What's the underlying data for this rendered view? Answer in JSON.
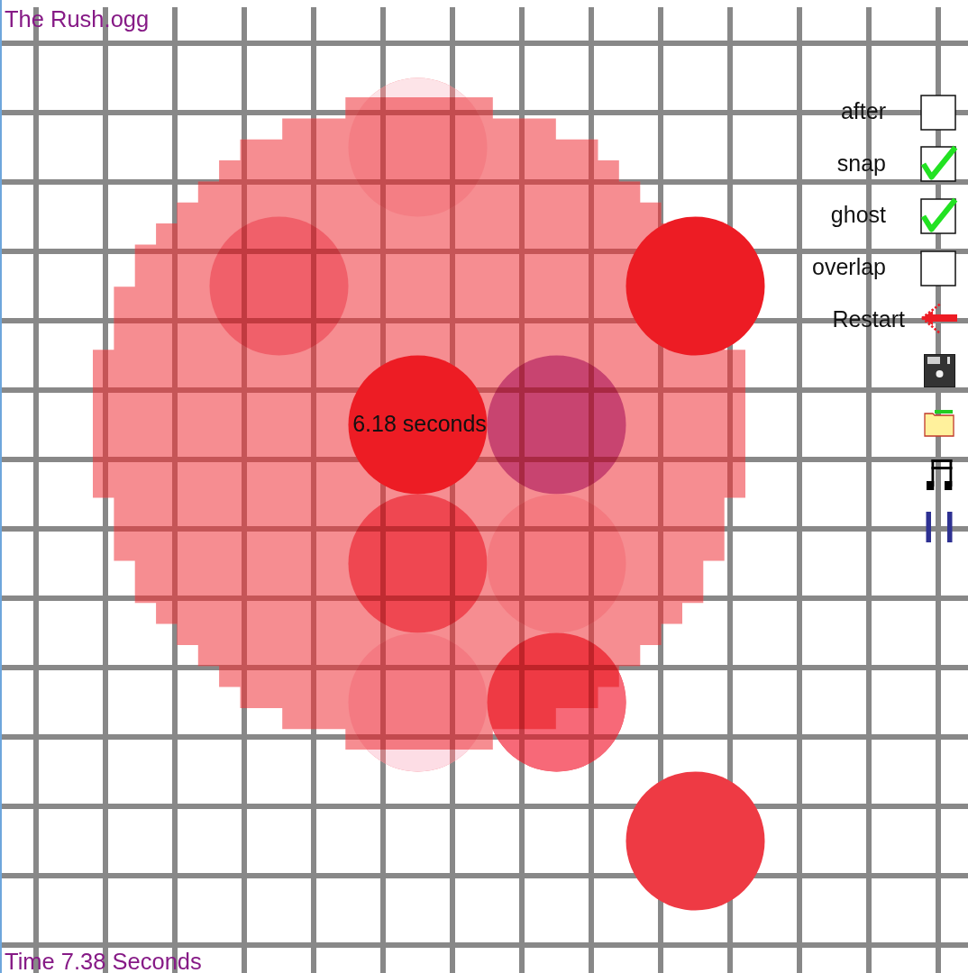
{
  "file": {
    "name": "The Rush.ogg"
  },
  "canvas": {
    "circles": [
      {
        "kind": "faded",
        "color": "#f47e84"
      },
      {
        "kind": "faded",
        "color": "#f0606a"
      },
      {
        "kind": "solid",
        "color": "#ed1c24"
      },
      {
        "kind": "solid",
        "color": "#ed1c24",
        "label": "6.18 seconds"
      },
      {
        "kind": "faded",
        "color": "#c84470"
      },
      {
        "kind": "faded",
        "color": "#ef4751"
      },
      {
        "kind": "faded",
        "color": "#f47a80"
      },
      {
        "kind": "faded",
        "color": "#f47a82"
      },
      {
        "kind": "faded",
        "color": "#ee3a44"
      },
      {
        "kind": "solid",
        "color": "#ee3a44"
      }
    ]
  },
  "options": [
    {
      "label": "after",
      "checked": false
    },
    {
      "label": "snap",
      "checked": true
    },
    {
      "label": "ghost",
      "checked": true
    },
    {
      "label": "overlap",
      "checked": false
    }
  ],
  "actions": [
    {
      "kind": "restart",
      "label": "Restart"
    },
    {
      "kind": "save"
    },
    {
      "kind": "open"
    },
    {
      "kind": "music"
    },
    {
      "kind": "pause"
    }
  ],
  "status": {
    "time": "Time 7.38 Seconds"
  }
}
